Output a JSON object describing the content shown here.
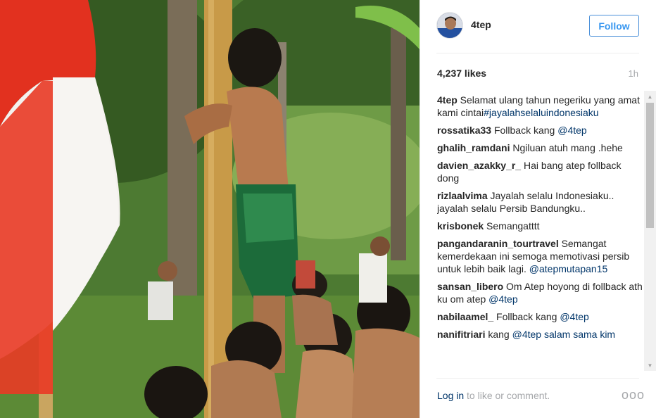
{
  "post": {
    "username": "4tep",
    "follow_label": "Follow",
    "likes": "4,237 likes",
    "time_ago": "1h",
    "login_link": "Log in",
    "login_suffix": " to like or comment.",
    "more_label": "ooo"
  },
  "comments": [
    {
      "user": "4tep",
      "text": " Selamat ulang tahun negeriku yang amat kami cintai",
      "mention": "#jayalahselaluindonesiaku"
    },
    {
      "user": "rossatika33",
      "text": " Follback kang ",
      "mention": "@4tep"
    },
    {
      "user": "ghalih_ramdani",
      "text": " Ngiluan atuh mang .hehe",
      "mention": ""
    },
    {
      "user": "davien_azakky_r_",
      "text": " Hai bang atep follback dong",
      "mention": ""
    },
    {
      "user": "rizlaalvima",
      "text": " Jayalah selalu Indonesiaku.. jayalah selalu Persib Bandungku..",
      "mention": ""
    },
    {
      "user": "krisbonek",
      "text": " Semangatttt",
      "mention": ""
    },
    {
      "user": "pangandaranin_tourtravel",
      "text": " Semangat kemerdekaan ini semoga memotivasi persib untuk lebih baik lagi. ",
      "mention": "@atepmutapan15"
    },
    {
      "user": "sansan_libero",
      "text": " Om Atep hoyong di follback ath ku om atep ",
      "mention": "@4tep"
    },
    {
      "user": "nabilaamel_",
      "text": " Follback kang ",
      "mention": "@4tep"
    },
    {
      "user": "nanifitriari",
      "text": " kang ",
      "mention": "@4tep salam sama kim"
    }
  ],
  "colors": {
    "follow_blue": "#3897f0",
    "link_navy": "#003569",
    "muted_gray": "#a5a7aa"
  },
  "icons": {
    "scroll_up": "▲",
    "scroll_down": "▼"
  }
}
